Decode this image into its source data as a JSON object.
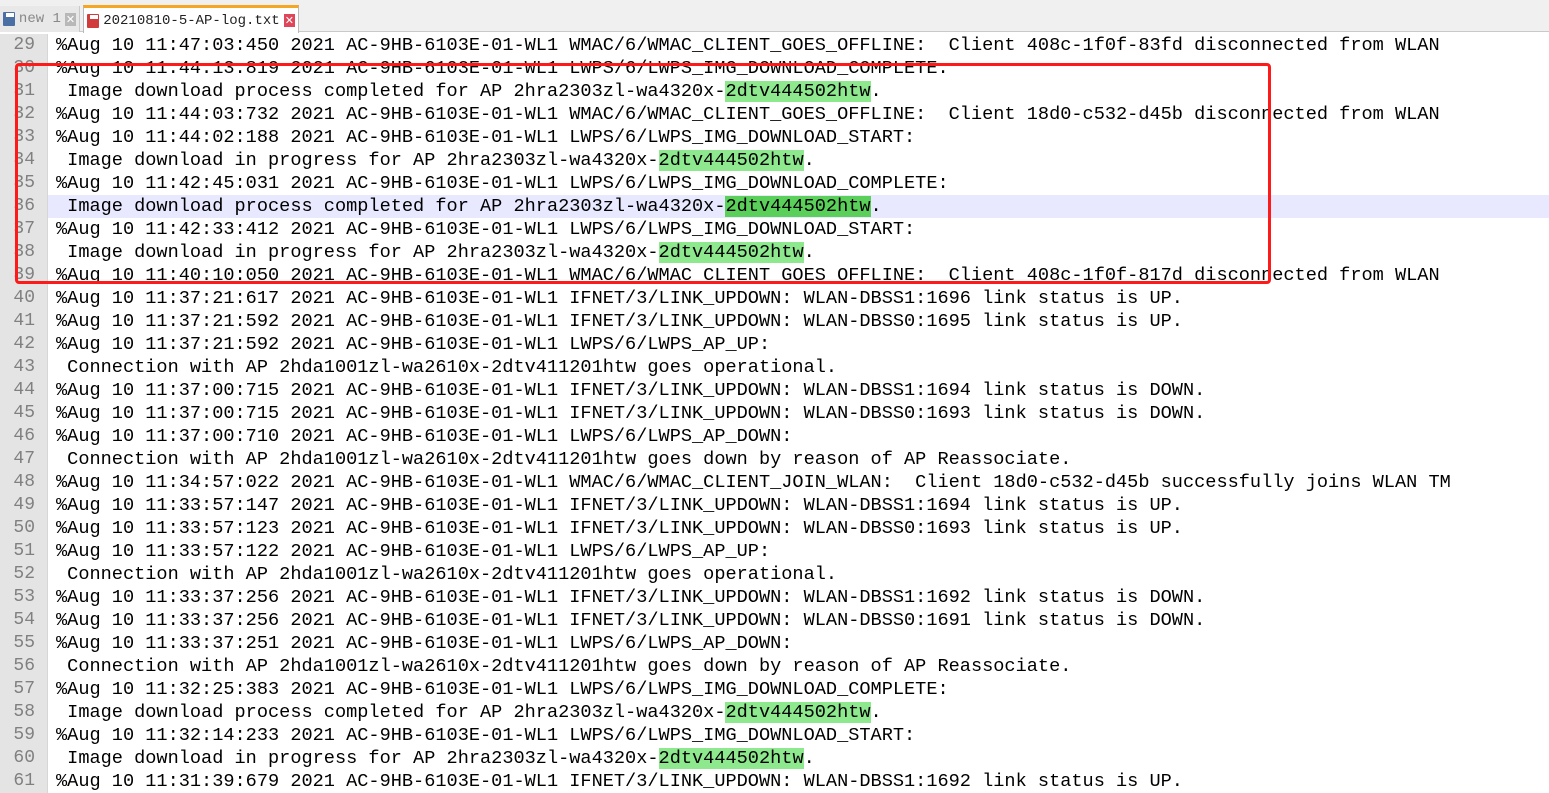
{
  "tabs": [
    {
      "label": "new 1",
      "icon": "save-icon"
    },
    {
      "label": "20210810-5-AP-log.txt",
      "icon": "save-icon"
    }
  ],
  "close_glyph": "✕",
  "highlight_term": "2dtv444502htw",
  "lines": [
    {
      "num": "29",
      "text": "%Aug 10 11:47:03:450 2021 AC-9HB-6103E-01-WL1 WMAC/6/WMAC_CLIENT_GOES_OFFLINE:  Client 408c-1f0f-83fd disconnected from WLAN"
    },
    {
      "num": "30",
      "text": "%Aug 10 11:44:13:819 2021 AC-9HB-6103E-01-WL1 LWPS/6/LWPS_IMG_DOWNLOAD_COMPLETE:"
    },
    {
      "num": "31",
      "text": " Image download process completed for AP 2hra2303zl-wa4320x-",
      "hl": "2dtv444502htw",
      "tail": "."
    },
    {
      "num": "32",
      "text": "%Aug 10 11:44:03:732 2021 AC-9HB-6103E-01-WL1 WMAC/6/WMAC_CLIENT_GOES_OFFLINE:  Client 18d0-c532-d45b disconnected from WLAN"
    },
    {
      "num": "33",
      "text": "%Aug 10 11:44:02:188 2021 AC-9HB-6103E-01-WL1 LWPS/6/LWPS_IMG_DOWNLOAD_START:"
    },
    {
      "num": "34",
      "text": " Image download in progress for AP 2hra2303zl-wa4320x-",
      "hl": "2dtv444502htw",
      "tail": "."
    },
    {
      "num": "35",
      "text": "%Aug 10 11:42:45:031 2021 AC-9HB-6103E-01-WL1 LWPS/6/LWPS_IMG_DOWNLOAD_COMPLETE:"
    },
    {
      "num": "36",
      "text": " Image download process completed for AP 2hra2303zl-wa4320x-",
      "hl": "2dtv444502htw",
      "tail": ".",
      "current": true
    },
    {
      "num": "37",
      "text": "%Aug 10 11:42:33:412 2021 AC-9HB-6103E-01-WL1 LWPS/6/LWPS_IMG_DOWNLOAD_START:"
    },
    {
      "num": "38",
      "text": " Image download in progress for AP 2hra2303zl-wa4320x-",
      "hl": "2dtv444502htw",
      "tail": "."
    },
    {
      "num": "39",
      "text": "%Aug 10 11:40:10:050 2021 AC-9HB-6103E-01-WL1 WMAC/6/WMAC_CLIENT_GOES_OFFLINE:  Client 408c-1f0f-817d disconnected from WLAN"
    },
    {
      "num": "40",
      "text": "%Aug 10 11:37:21:617 2021 AC-9HB-6103E-01-WL1 IFNET/3/LINK_UPDOWN: WLAN-DBSS1:1696 link status is UP."
    },
    {
      "num": "41",
      "text": "%Aug 10 11:37:21:592 2021 AC-9HB-6103E-01-WL1 IFNET/3/LINK_UPDOWN: WLAN-DBSS0:1695 link status is UP."
    },
    {
      "num": "42",
      "text": "%Aug 10 11:37:21:592 2021 AC-9HB-6103E-01-WL1 LWPS/6/LWPS_AP_UP:"
    },
    {
      "num": "43",
      "text": " Connection with AP 2hda1001zl-wa2610x-2dtv411201htw goes operational."
    },
    {
      "num": "44",
      "text": "%Aug 10 11:37:00:715 2021 AC-9HB-6103E-01-WL1 IFNET/3/LINK_UPDOWN: WLAN-DBSS1:1694 link status is DOWN."
    },
    {
      "num": "45",
      "text": "%Aug 10 11:37:00:715 2021 AC-9HB-6103E-01-WL1 IFNET/3/LINK_UPDOWN: WLAN-DBSS0:1693 link status is DOWN."
    },
    {
      "num": "46",
      "text": "%Aug 10 11:37:00:710 2021 AC-9HB-6103E-01-WL1 LWPS/6/LWPS_AP_DOWN:"
    },
    {
      "num": "47",
      "text": " Connection with AP 2hda1001zl-wa2610x-2dtv411201htw goes down by reason of AP Reassociate."
    },
    {
      "num": "48",
      "text": "%Aug 10 11:34:57:022 2021 AC-9HB-6103E-01-WL1 WMAC/6/WMAC_CLIENT_JOIN_WLAN:  Client 18d0-c532-d45b successfully joins WLAN TM"
    },
    {
      "num": "49",
      "text": "%Aug 10 11:33:57:147 2021 AC-9HB-6103E-01-WL1 IFNET/3/LINK_UPDOWN: WLAN-DBSS1:1694 link status is UP."
    },
    {
      "num": "50",
      "text": "%Aug 10 11:33:57:123 2021 AC-9HB-6103E-01-WL1 IFNET/3/LINK_UPDOWN: WLAN-DBSS0:1693 link status is UP."
    },
    {
      "num": "51",
      "text": "%Aug 10 11:33:57:122 2021 AC-9HB-6103E-01-WL1 LWPS/6/LWPS_AP_UP:"
    },
    {
      "num": "52",
      "text": " Connection with AP 2hda1001zl-wa2610x-2dtv411201htw goes operational."
    },
    {
      "num": "53",
      "text": "%Aug 10 11:33:37:256 2021 AC-9HB-6103E-01-WL1 IFNET/3/LINK_UPDOWN: WLAN-DBSS1:1692 link status is DOWN."
    },
    {
      "num": "54",
      "text": "%Aug 10 11:33:37:256 2021 AC-9HB-6103E-01-WL1 IFNET/3/LINK_UPDOWN: WLAN-DBSS0:1691 link status is DOWN."
    },
    {
      "num": "55",
      "text": "%Aug 10 11:33:37:251 2021 AC-9HB-6103E-01-WL1 LWPS/6/LWPS_AP_DOWN:"
    },
    {
      "num": "56",
      "text": " Connection with AP 2hda1001zl-wa2610x-2dtv411201htw goes down by reason of AP Reassociate."
    },
    {
      "num": "57",
      "text": "%Aug 10 11:32:25:383 2021 AC-9HB-6103E-01-WL1 LWPS/6/LWPS_IMG_DOWNLOAD_COMPLETE:"
    },
    {
      "num": "58",
      "text": " Image download process completed for AP 2hra2303zl-wa4320x-",
      "hl": "2dtv444502htw",
      "tail": "."
    },
    {
      "num": "59",
      "text": "%Aug 10 11:32:14:233 2021 AC-9HB-6103E-01-WL1 LWPS/6/LWPS_IMG_DOWNLOAD_START:"
    },
    {
      "num": "60",
      "text": " Image download in progress for AP 2hra2303zl-wa4320x-",
      "hl": "2dtv444502htw",
      "tail": "."
    },
    {
      "num": "61",
      "text": "%Aug 10 11:31:39:679 2021 AC-9HB-6103E-01-WL1 IFNET/3/LINK_UPDOWN: WLAN-DBSS1:1692 link status is UP."
    }
  ],
  "colors": {
    "highlight": "#8ee88e",
    "current_line": "#e8e8ff",
    "annotation_box": "#ff1a1a"
  }
}
